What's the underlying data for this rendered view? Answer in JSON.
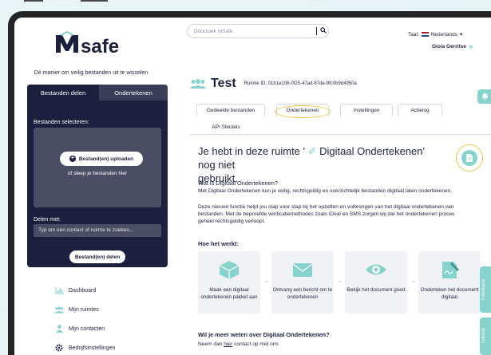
{
  "brand": {
    "logo_text": "Msafe",
    "tagline": "Dé manier om veilig bestanden uit te wisselen",
    "accent": "#86d2cd",
    "navy": "#1c1f3d",
    "highlight": "#f0c53c"
  },
  "share_panel": {
    "tabs": [
      "Bestanden delen",
      "Ondertekenen"
    ],
    "select_label": "Bestanden selecteren:",
    "upload_button": "Bestand(en) uploaden",
    "drop_hint": "of sleep je bestanden hier",
    "share_label": "Delen met:",
    "share_placeholder": "Typ om een contact of ruimte te zoeken...",
    "share_button": "Bestand(en) delen"
  },
  "sidebar": {
    "items": [
      {
        "label": "Dashboard",
        "icon": "chart-icon"
      },
      {
        "label": "Mijn ruimtes",
        "icon": "people-icon"
      },
      {
        "label": "Mijn contacten",
        "icon": "person-icon"
      },
      {
        "label": "Bedrijfsinstellingen",
        "icon": "gear-icon"
      }
    ]
  },
  "header": {
    "search_placeholder": "Doorzoek mSafe",
    "language_label": "Taal:",
    "language": "Nederlands",
    "user_name": "Gioia Gerritse"
  },
  "room": {
    "name": "Test",
    "id_text": "Ruimte ID: 01b1e106-0f25-47ad-87de-9fc0b9d4950a",
    "tabs": [
      "Gedeelde bestanden",
      "Ondertekenen",
      "Instellingen",
      "Actielog",
      "API Sleutels"
    ],
    "active_tab": "Ondertekenen"
  },
  "content": {
    "heading_line1": "Je hebt in deze ruimte '",
    "heading_feature": "Digitaal Ondertekenen",
    "heading_line1_end": "' nog niet",
    "heading_line2": "gebruikt.",
    "what_title": "Wat is Digitaal Ondertekenen?",
    "what_text": "Met Digitaal Ondertekenen kun je veilig, rechtsgeldig en overzichtelijk bestanden digitaal laten ondertekenen.",
    "new_text": "Deze nieuwe functie helpt jou stap voor stap bij het opzetten en volbrengen van het digitaal ondertekenen van bestanden. Met de beproefde verificatiemethodes zoals iDeal en SMS zorgen wij dat het ondertekenen proces geheel rechtsgeldig verloopt.",
    "how_title": "Hoe het werkt:",
    "steps": [
      {
        "text": "Maak een digitaal ondertekenen pakket aan",
        "icon": "box-icon"
      },
      {
        "text": "Ontvang een bericht om te ondertekenen",
        "icon": "envelope-icon"
      },
      {
        "text": "Bekijk het document goed",
        "icon": "eye-icon"
      },
      {
        "text": "Onderteken het document digitaal",
        "icon": "signature-icon"
      }
    ],
    "more_title": "Wil je meer weten over Digitaal Ondertekenen?",
    "more_text_pre": "Neem dan ",
    "more_link": "hier",
    "more_text_post": " contact op met ons"
  },
  "side_tabs": [
    "Feedback",
    "Tutorial"
  ]
}
